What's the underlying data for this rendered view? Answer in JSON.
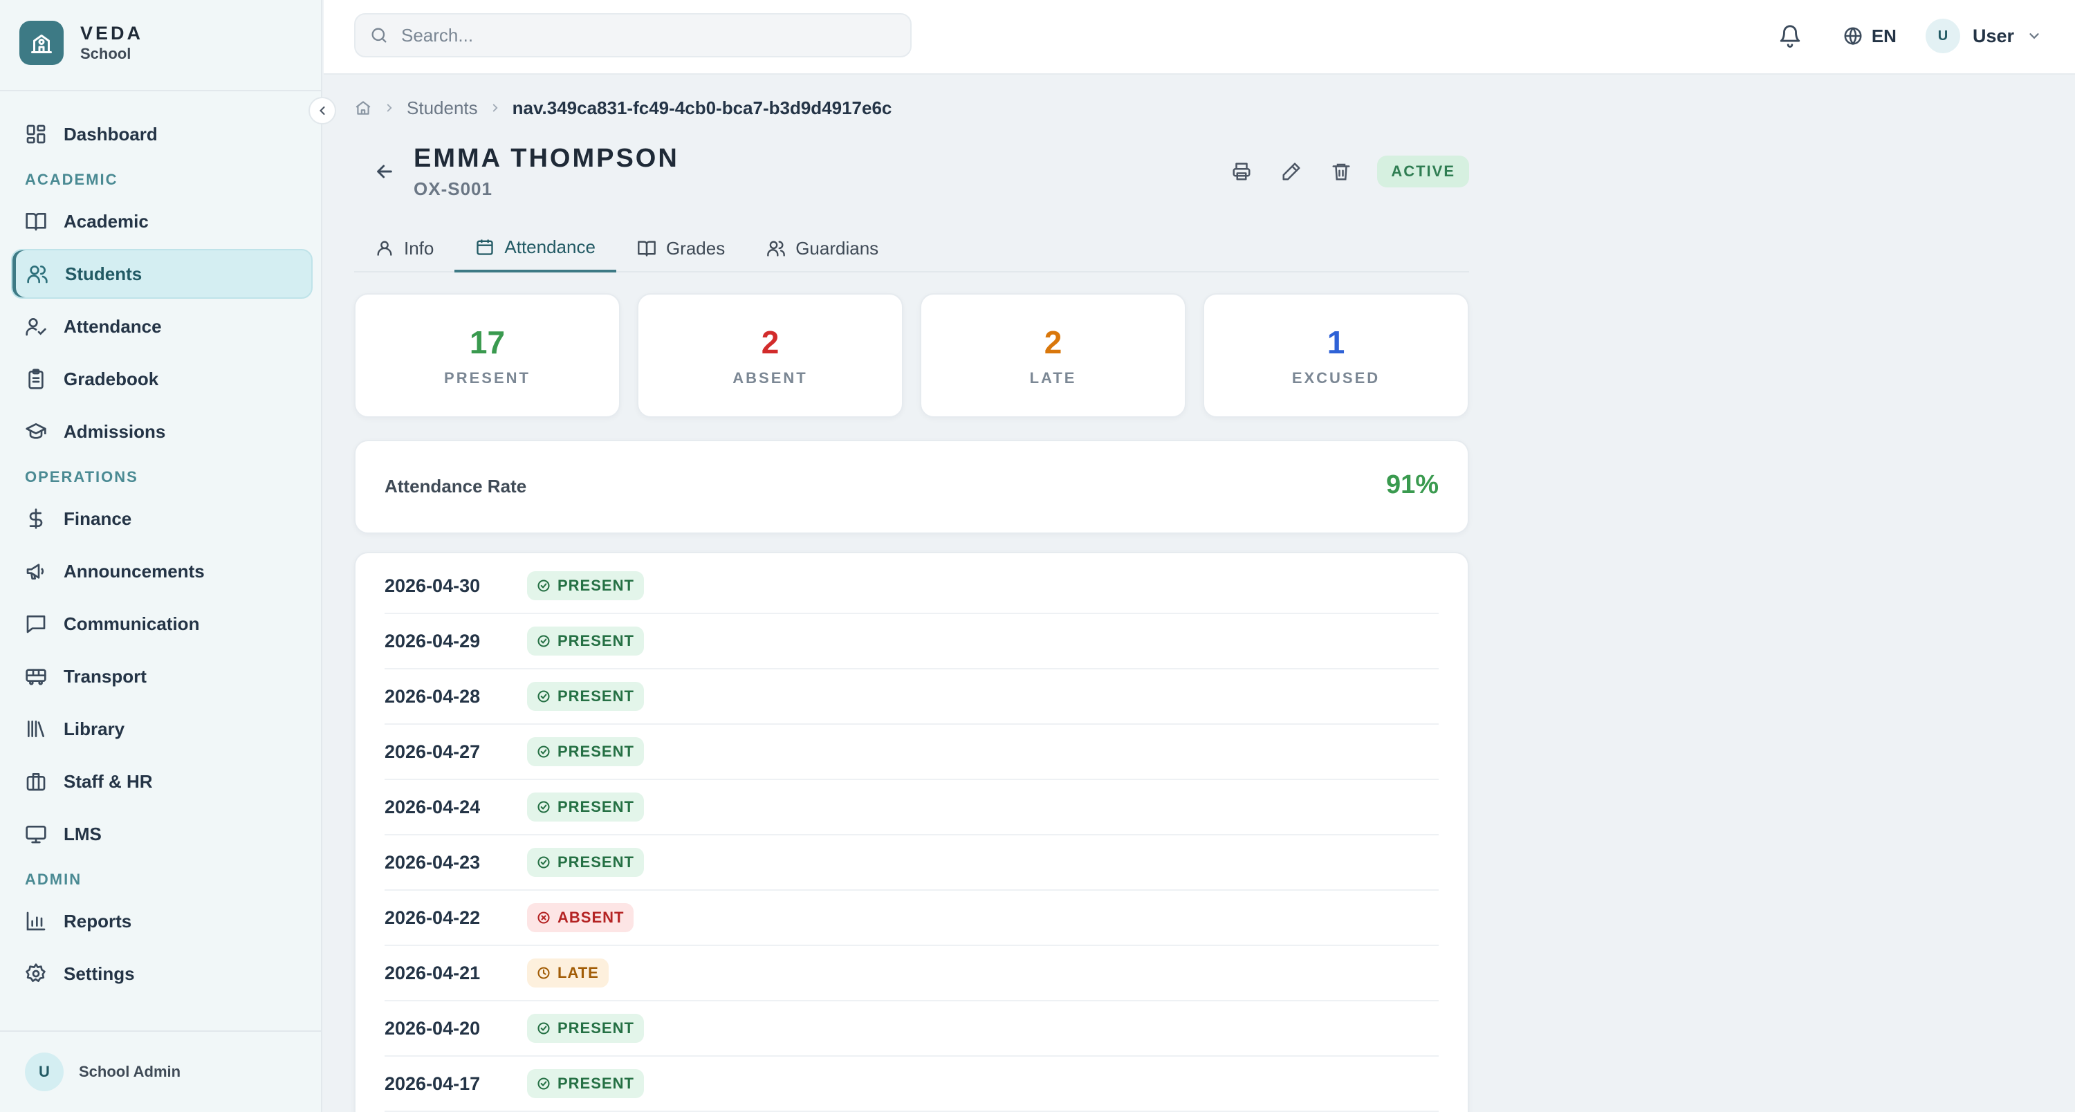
{
  "brand": {
    "name": "VEDA",
    "subtitle": "School"
  },
  "sidebar": {
    "items": [
      {
        "label": "Dashboard"
      },
      {
        "section": "ACADEMIC"
      },
      {
        "label": "Academic"
      },
      {
        "label": "Students",
        "active": true
      },
      {
        "label": "Attendance"
      },
      {
        "label": "Gradebook"
      },
      {
        "label": "Admissions"
      },
      {
        "section": "OPERATIONS"
      },
      {
        "label": "Finance"
      },
      {
        "label": "Announcements"
      },
      {
        "label": "Communication"
      },
      {
        "label": "Transport"
      },
      {
        "label": "Library"
      },
      {
        "label": "Staff & HR"
      },
      {
        "label": "LMS"
      },
      {
        "section": "ADMIN"
      },
      {
        "label": "Reports"
      },
      {
        "label": "Settings"
      }
    ],
    "footer": {
      "avatar": "U",
      "name": "School Admin"
    }
  },
  "topbar": {
    "search_placeholder": "Search...",
    "language": "EN",
    "user_avatar": "U",
    "user_name": "User"
  },
  "breadcrumb": {
    "items": [
      "Students",
      "nav.349ca831-fc49-4cb0-bca7-b3d9d4917e6c"
    ]
  },
  "student": {
    "name": "EMMA THOMPSON",
    "id": "OX-S001",
    "status": "ACTIVE"
  },
  "tabs": [
    {
      "label": "Info"
    },
    {
      "label": "Attendance",
      "active": true
    },
    {
      "label": "Grades"
    },
    {
      "label": "Guardians"
    }
  ],
  "stats": [
    {
      "value": "17",
      "label": "PRESENT",
      "color": "#3a9a4f"
    },
    {
      "value": "2",
      "label": "ABSENT",
      "color": "#d22b2b"
    },
    {
      "value": "2",
      "label": "LATE",
      "color": "#d9770b"
    },
    {
      "value": "1",
      "label": "EXCUSED",
      "color": "#2f62d6"
    }
  ],
  "attendance_rate": {
    "label": "Attendance Rate",
    "value": "91%",
    "color": "#3a9a4f"
  },
  "records": [
    {
      "date": "2026-04-30",
      "status": "PRESENT",
      "type": "present"
    },
    {
      "date": "2026-04-29",
      "status": "PRESENT",
      "type": "present"
    },
    {
      "date": "2026-04-28",
      "status": "PRESENT",
      "type": "present"
    },
    {
      "date": "2026-04-27",
      "status": "PRESENT",
      "type": "present"
    },
    {
      "date": "2026-04-24",
      "status": "PRESENT",
      "type": "present"
    },
    {
      "date": "2026-04-23",
      "status": "PRESENT",
      "type": "present"
    },
    {
      "date": "2026-04-22",
      "status": "ABSENT",
      "type": "absent"
    },
    {
      "date": "2026-04-21",
      "status": "LATE",
      "type": "late"
    },
    {
      "date": "2026-04-20",
      "status": "PRESENT",
      "type": "present"
    },
    {
      "date": "2026-04-17",
      "status": "PRESENT",
      "type": "present"
    }
  ]
}
